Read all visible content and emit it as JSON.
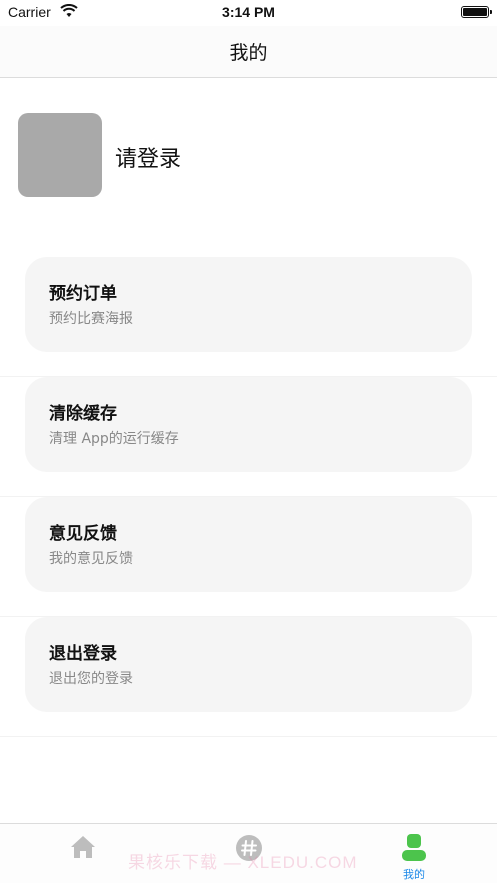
{
  "status_bar": {
    "carrier": "Carrier",
    "time": "3:14 PM"
  },
  "nav": {
    "title": "我的"
  },
  "profile": {
    "login_text": "请登录"
  },
  "menu": [
    {
      "title": "预约订单",
      "subtitle": "预约比赛海报"
    },
    {
      "title": "清除缓存",
      "subtitle": "清理 App的运行缓存"
    },
    {
      "title": "意见反馈",
      "subtitle": "我的意见反馈"
    },
    {
      "title": "退出登录",
      "subtitle": "退出您的登录"
    }
  ],
  "tabs": [
    {
      "icon": "home-icon",
      "label": ""
    },
    {
      "icon": "hashtag-icon",
      "label": ""
    },
    {
      "icon": "user-icon",
      "label": "我的",
      "active": true
    }
  ],
  "watermark": "果核乐下载 — XLEDU.COM",
  "colors": {
    "accent": "#1a88e8",
    "active_icon": "#4cc44c",
    "inactive_icon": "#bdbdbd",
    "card_bg": "#f5f5f5",
    "avatar_bg": "#a9a9a9"
  }
}
